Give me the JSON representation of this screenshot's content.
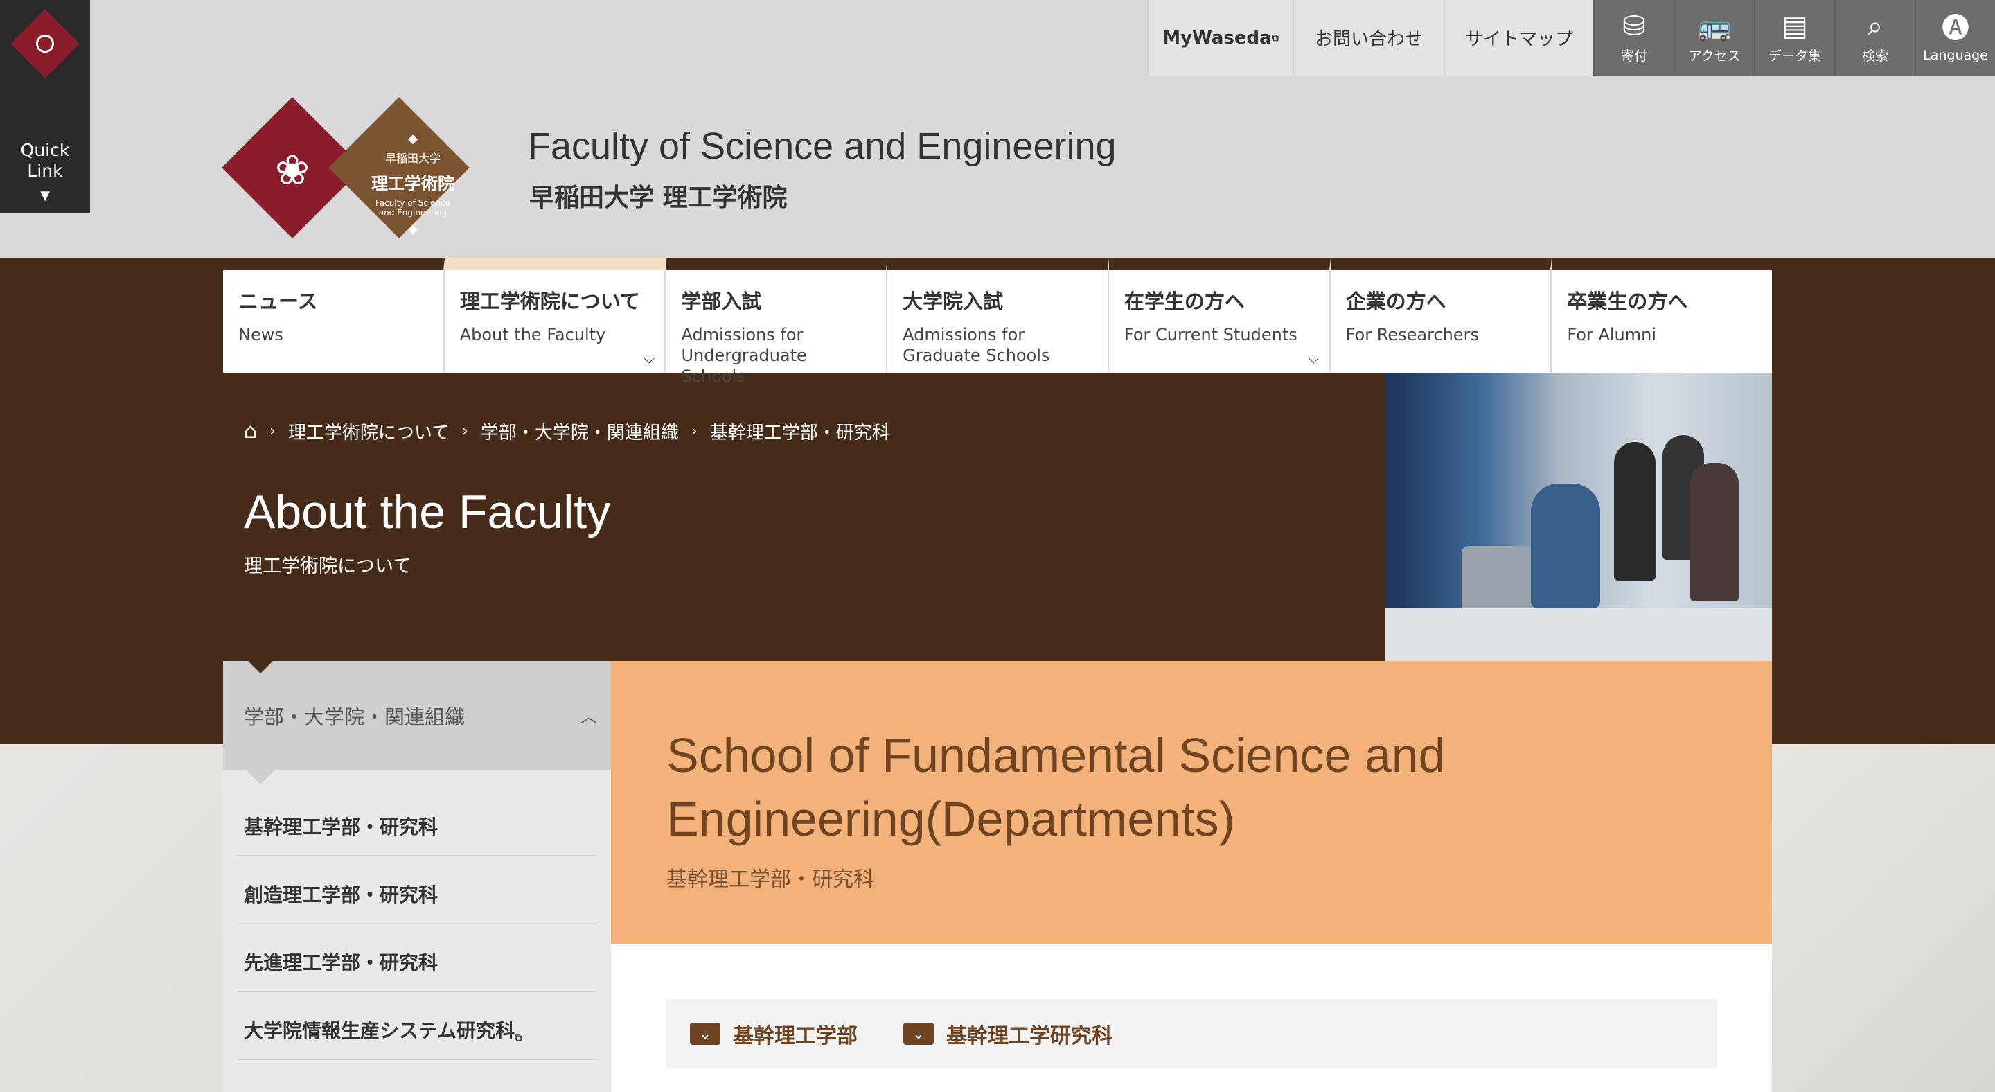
{
  "quick_link": {
    "label_line1": "Quick",
    "label_line2": "Link",
    "arrow": "▼"
  },
  "topbar": {
    "mywaseda": "MyWaseda",
    "contact": "お問い合わせ",
    "sitemap": "サイトマップ",
    "icons": [
      {
        "icon": "donation-icon",
        "glyph": "⛁",
        "label": "寄付"
      },
      {
        "icon": "bus-icon",
        "glyph": "🚌",
        "label": "アクセス"
      },
      {
        "icon": "data-book-icon",
        "glyph": "▤",
        "label": "データ集"
      },
      {
        "icon": "search-icon",
        "glyph": "⌕",
        "label": "検索"
      },
      {
        "icon": "language-icon",
        "glyph": "🅐",
        "label": "Language"
      }
    ]
  },
  "logo": {
    "badge_top": "早稲田大学",
    "badge_main": "理工学術院",
    "badge_en_line1": "Faculty of Science",
    "badge_en_line2": "and Engineering"
  },
  "site": {
    "title": "Faculty of Science and Engineering",
    "subtitle": "早稲田大学 理工学術院"
  },
  "nav": [
    {
      "jp": "ニュース",
      "en": "News"
    },
    {
      "jp": "理工学術院について",
      "en": "About the Faculty"
    },
    {
      "jp": "学部入試",
      "en": "Admissions for Undergraduate Schools"
    },
    {
      "jp": "大学院入試",
      "en": "Admissions for Graduate Schools"
    },
    {
      "jp": "在学生の方へ",
      "en": "For Current Students"
    },
    {
      "jp": "企業の方へ",
      "en": "For Researchers"
    },
    {
      "jp": "卒業生の方へ",
      "en": "For Alumni"
    }
  ],
  "breadcrumb": [
    "理工学術院について",
    "学部・大学院・関連組織",
    "基幹理工学部・研究科"
  ],
  "page": {
    "title": "About the Faculty",
    "subtitle": "理工学術院について"
  },
  "sidebar": {
    "heading": "学部・大学院・関連組織",
    "items": [
      "基幹理工学部・研究科",
      "創造理工学部・研究科",
      "先進理工学部・研究科",
      "大学院情報生産システム研究科"
    ]
  },
  "hero": {
    "title": "School of Fundamental Science and Engineering(Departments)",
    "subtitle": "基幹理工学部・研究科"
  },
  "tabs": [
    "基幹理工学部",
    "基幹理工学研究科"
  ],
  "colors": {
    "brown": "#452b18",
    "crimson": "#8a1c2b",
    "hero_bg": "#f2b27a",
    "accent_text": "#6e4423"
  }
}
